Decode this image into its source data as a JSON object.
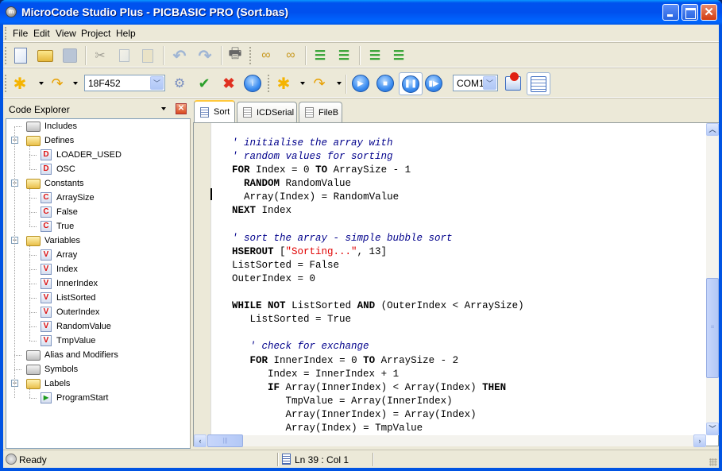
{
  "window": {
    "title": "MicroCode Studio Plus - PICBASIC PRO (Sort.bas)",
    "controls": {
      "minimize": "minimize",
      "maximize": "maximize",
      "close": "✕"
    }
  },
  "menu": [
    "File",
    "Edit",
    "View",
    "Project",
    "Help"
  ],
  "toolbar1": {
    "buttons": [
      "new-file",
      "open-file",
      "save",
      "cut",
      "copy",
      "paste",
      "undo",
      "redo",
      "print",
      "find",
      "find-replace",
      "indent",
      "outdent",
      "comment-block",
      "uncomment-block"
    ]
  },
  "toolbar2": {
    "device": "18F452",
    "buttons": [
      "new-project",
      "open-project",
      "compile",
      "compile-program",
      "stop-compile",
      "device-info",
      "new-window",
      "open-window",
      "run",
      "stop",
      "pause",
      "step"
    ],
    "com_port": "COM1",
    "extra_buttons": [
      "break",
      "serial-monitor"
    ]
  },
  "explorer": {
    "title": "Code Explorer",
    "close": "✕",
    "tree": [
      {
        "label": "Includes",
        "type": "folder",
        "open": false,
        "children": []
      },
      {
        "label": "Defines",
        "type": "folder",
        "open": true,
        "children": [
          {
            "label": "LOADER_USED",
            "badge": "D"
          },
          {
            "label": "OSC",
            "badge": "D"
          }
        ]
      },
      {
        "label": "Constants",
        "type": "folder",
        "open": true,
        "children": [
          {
            "label": "ArraySize",
            "badge": "C"
          },
          {
            "label": "False",
            "badge": "C"
          },
          {
            "label": "True",
            "badge": "C"
          }
        ]
      },
      {
        "label": "Variables",
        "type": "folder",
        "open": true,
        "children": [
          {
            "label": "Array",
            "badge": "V"
          },
          {
            "label": "Index",
            "badge": "V"
          },
          {
            "label": "InnerIndex",
            "badge": "V"
          },
          {
            "label": "ListSorted",
            "badge": "V"
          },
          {
            "label": "OuterIndex",
            "badge": "V"
          },
          {
            "label": "RandomValue",
            "badge": "V"
          },
          {
            "label": "TmpValue",
            "badge": "V"
          }
        ]
      },
      {
        "label": "Alias and Modifiers",
        "type": "folder",
        "open": false,
        "children": []
      },
      {
        "label": "Symbols",
        "type": "folder",
        "open": false,
        "children": []
      },
      {
        "label": "Labels",
        "type": "folder",
        "open": true,
        "children": [
          {
            "label": "ProgramStart",
            "badge": "▶"
          }
        ]
      }
    ]
  },
  "tabs": [
    {
      "label": "Sort",
      "active": true
    },
    {
      "label": "ICDSerial",
      "active": false
    },
    {
      "label": "FileB",
      "active": false
    }
  ],
  "code_lines": [
    "' initialise the array with",
    "' random values for sorting",
    "FOR Index = 0 TO ArraySize - 1",
    "  RANDOM RandomValue",
    "  Array(Index) = RandomValue",
    "NEXT Index",
    "",
    "' sort the array - simple bubble sort",
    "HSEROUT [\"Sorting...\", 13]",
    "ListSorted = False",
    "OuterIndex = 0",
    "",
    "WHILE NOT ListSorted AND (OuterIndex < ArraySize)",
    "   ListSorted = True",
    "",
    "   ' check for exchange",
    "   FOR InnerIndex = 0 TO ArraySize - 2",
    "      Index = InnerIndex + 1",
    "      IF Array(InnerIndex) < Array(Index) THEN",
    "         TmpValue = Array(InnerIndex)",
    "         Array(InnerIndex) = Array(Index)",
    "         Array(Index) = TmpValue"
  ],
  "keywords": [
    "FOR",
    "TO",
    "RANDOM",
    "NEXT",
    "HSEROUT",
    "WHILE",
    "NOT",
    "AND",
    "IF",
    "THEN"
  ],
  "status": {
    "ready": "Ready",
    "position": "Ln 39 : Col 1"
  }
}
